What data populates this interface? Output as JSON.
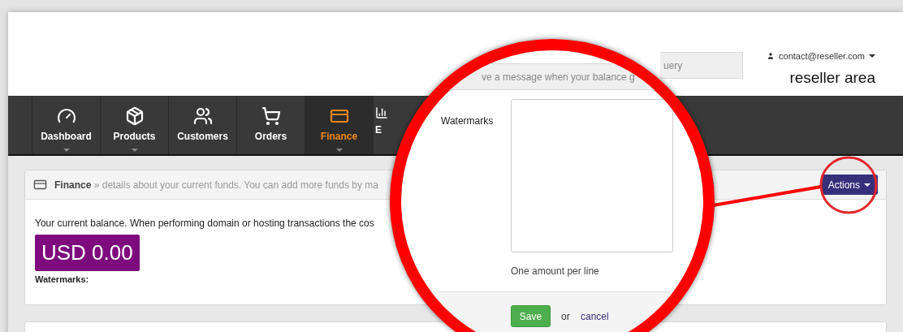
{
  "header": {
    "message_field": {
      "visible_text": "ve a message when your balance g",
      "trailing_text": "uery"
    },
    "user": "contact@reseller.com",
    "area_title": "reseller area"
  },
  "nav": [
    {
      "label": "Dashboard",
      "has_menu": true,
      "selected": false
    },
    {
      "label": "Products",
      "has_menu": true,
      "selected": false
    },
    {
      "label": "Customers",
      "has_menu": false,
      "selected": false
    },
    {
      "label": "Orders",
      "has_menu": false,
      "selected": false
    },
    {
      "label": "Finance",
      "has_menu": true,
      "selected": true
    },
    {
      "label": "E",
      "has_menu": false,
      "selected": false
    }
  ],
  "finance_panel": {
    "title": "Finance",
    "description": "» details about your current funds. You can add more funds by ma",
    "actions_button": "Actions",
    "balance_text": "Your current balance. When performing domain or hosting transactions the cos",
    "balance": "USD 0.00",
    "watermarks_label": "Watermarks:"
  },
  "magnifier": {
    "field_label": "Watermarks",
    "help_text": "One amount per line",
    "save_button": "Save",
    "or_text": "or",
    "cancel_link": "cancel"
  }
}
